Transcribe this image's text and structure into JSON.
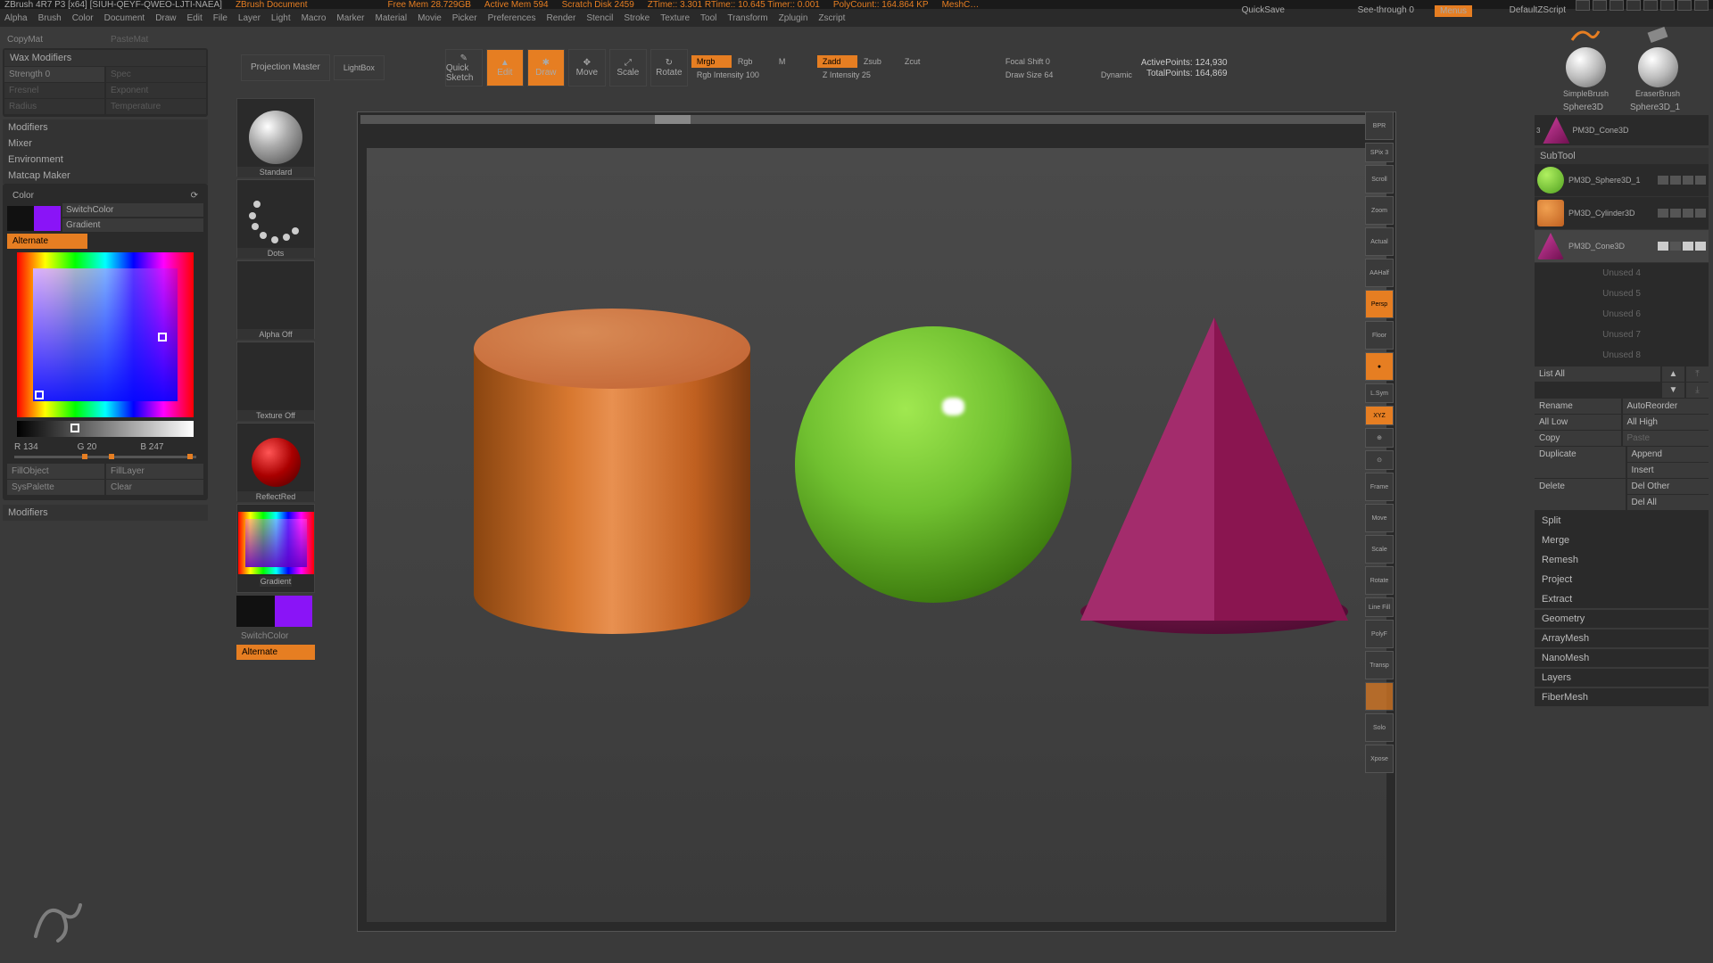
{
  "title": {
    "app": "ZBrush 4R7 P3  [x64] [SIUH-QEYF-QWEO-LJTI-NAEA]",
    "doc": "ZBrush Document",
    "freemem": "Free Mem  28.729GB",
    "activemem": "Active Mem  594",
    "scratch": "Scratch Disk  2459",
    "ztime": "ZTime::  3.301  RTime:: 10.645  Timer:: 0.001",
    "polycount": "PolyCount:: 164.864 KP",
    "meshc": "MeshC…",
    "quicksave": "QuickSave",
    "seethrough": "See-through   0",
    "menus": "Menus",
    "defaultscript": "DefaultZScript"
  },
  "menu": [
    "Alpha",
    "Brush",
    "Color",
    "Document",
    "Draw",
    "Edit",
    "File",
    "Layer",
    "Light",
    "Macro",
    "Marker",
    "Material",
    "Movie",
    "Picker",
    "Preferences",
    "Render",
    "Stencil",
    "Stroke",
    "Texture",
    "Tool",
    "Transform",
    "Zplugin",
    "Zscript"
  ],
  "leftTop": {
    "copymat": "CopyMat",
    "pastemat": "PasteMat"
  },
  "wax": {
    "hdr": "Wax Modifiers",
    "strength": "Strength 0",
    "spec": "Spec",
    "fresnel": "Fresnel",
    "exponent": "Exponent",
    "radius": "Radius",
    "temperature": "Temperature"
  },
  "mods": {
    "modifiers": "Modifiers",
    "mixer": "Mixer",
    "env": "Environment",
    "matcap": "Matcap Maker"
  },
  "color": {
    "hdr": "Color",
    "switch": "SwitchColor",
    "gradient": "Gradient",
    "alternate": "Alternate",
    "r": "R 134",
    "g": "G 20",
    "b": "B 247",
    "fillobj": "FillObject",
    "filllayer": "FillLayer",
    "syspal": "SysPalette",
    "clear": "Clear",
    "modifiers": "Modifiers"
  },
  "toolcol": {
    "standard": "Standard",
    "dots": "Dots",
    "alphaoff": "Alpha  Off",
    "texoff": "Texture  Off",
    "reflred": "ReflectRed",
    "gradient": "Gradient",
    "switch": "SwitchColor",
    "alternate": "Alternate"
  },
  "toolbar": {
    "projmaster": "Projection Master",
    "lightbox": "LightBox",
    "quicksketch": "Quick Sketch",
    "edit": "Edit",
    "draw": "Draw",
    "move": "Move",
    "scale": "Scale",
    "rotate": "Rotate",
    "mrgb": "Mrgb",
    "rgb": "Rgb",
    "m": "M",
    "rgbint": "Rgb Intensity 100",
    "zadd": "Zadd",
    "zsub": "Zsub",
    "zcut": "Zcut",
    "zint": "Z Intensity 25",
    "focal": "Focal Shift 0",
    "drawsize": "Draw Size  64",
    "dynamic": "Dynamic",
    "apoints": "ActivePoints:  124,930",
    "tpoints": "TotalPoints:  164,869"
  },
  "rtb": [
    "BPR",
    "SPix 3",
    "Scroll",
    "Zoom",
    "Actual",
    "AAHalf",
    "",
    "Persp",
    "Floor",
    "",
    "",
    "XYZ",
    "",
    "",
    "Frame",
    "",
    "Move",
    "",
    "Scale",
    "",
    "Rotate",
    "Line Fill",
    "PolyF",
    "",
    "Transp",
    "",
    "",
    "Solo",
    "",
    "Xpose"
  ],
  "brushes": {
    "simple": "SimpleBrush",
    "eraser": "EraserBrush",
    "s1": "Sphere3D",
    "s2": "Sphere3D_1",
    "cone": "PM3D_Cone3D"
  },
  "subtool": {
    "hdr": "SubTool",
    "items": [
      {
        "name": "PM3D_Sphere3D_1",
        "color": "radial-gradient(circle at 35% 30%,#b0f060,#50a020)"
      },
      {
        "name": "PM3D_Cylinder3D",
        "color": "radial-gradient(circle at 35% 30%,#f0a050,#c06020)"
      },
      {
        "name": "PM3D_Cone3D",
        "color": "linear-gradient(135deg,#d040a0,#701050)"
      }
    ],
    "empty": [
      "Unused 4",
      "Unused 5",
      "Unused 6",
      "Unused 7",
      "Unused 8"
    ],
    "listall": "List All",
    "rename": "Rename",
    "autoreorder": "AutoReorder",
    "alllow": "All Low",
    "allhigh": "All High",
    "copy": "Copy",
    "paste": "Paste",
    "duplicate": "Duplicate",
    "append": "Append",
    "insert": "Insert",
    "delete": "Delete",
    "delother": "Del Other",
    "delall": "Del All",
    "split": "Split",
    "merge": "Merge",
    "remesh": "Remesh",
    "project": "Project",
    "extract": "Extract",
    "geometry": "Geometry",
    "arraymesh": "ArrayMesh",
    "nanomesh": "NanoMesh",
    "layers": "Layers",
    "fibermesh": "FiberMesh"
  }
}
